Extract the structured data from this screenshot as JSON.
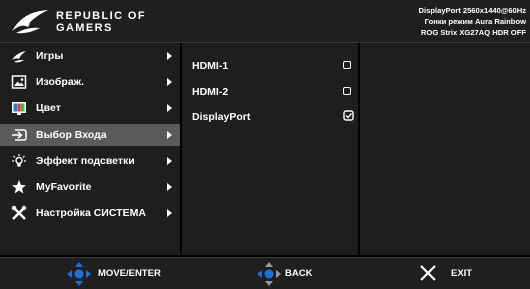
{
  "header": {
    "brand_line1": "REPUBLIC OF",
    "brand_line2": "GAMERS",
    "status_line1": "DisplayPort 2560x1440@60Hz",
    "status_line2": "Гонки режим  Aura Rainbow",
    "status_line3": "ROG Strix XG27AQ HDR OFF"
  },
  "menu": {
    "items": [
      {
        "label": "Игры",
        "icon": "gaming-claw-icon"
      },
      {
        "label": "Изображ.",
        "icon": "image-icon"
      },
      {
        "label": "Цвет",
        "icon": "color-palette-icon"
      },
      {
        "label": "Выбор Входа",
        "icon": "input-select-icon",
        "selected": true
      },
      {
        "label": "Эффект подсветки",
        "icon": "light-bulb-icon"
      },
      {
        "label": "MyFavorite",
        "icon": "star-icon"
      },
      {
        "label": "Настройка СИСТЕМА",
        "icon": "wrench-tools-icon"
      }
    ]
  },
  "submenu": {
    "items": [
      {
        "label": "HDMI-1",
        "checked": false
      },
      {
        "label": "HDMI-2",
        "checked": false
      },
      {
        "label": "DisplayPort",
        "checked": true
      }
    ]
  },
  "footer": {
    "move_label": "MOVE/ENTER",
    "back_label": "BACK",
    "exit_label": "EXIT"
  },
  "colors": {
    "background": "#000000",
    "panel": "#1e1e1e",
    "selected_row": "#5a5a5a",
    "accent_blue": "#1e6fd9",
    "text": "#ffffff"
  }
}
